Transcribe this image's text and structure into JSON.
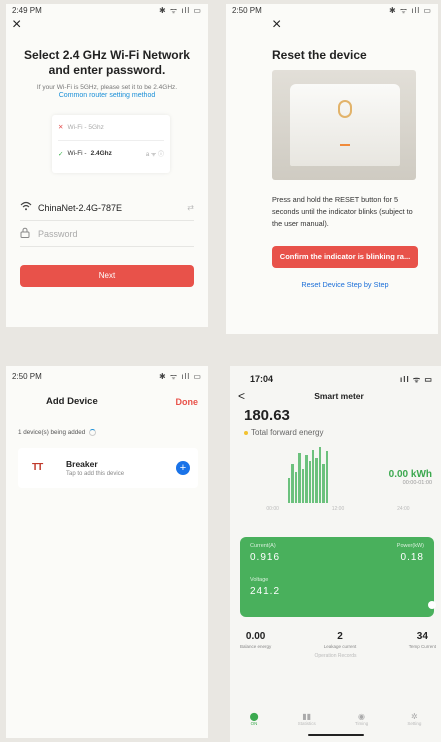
{
  "panel1": {
    "time": "2:49 PM",
    "sys_icons": "✱ ᯤ ıll ▭",
    "close": "×",
    "title": "Select 2.4 GHz Wi-Fi Network and enter password.",
    "subtitle": "If your Wi-Fi is 5GHz, please set it to be 2.4GHz.",
    "link": "Common router setting method",
    "wifi_bad": "Wi-Fi - 5Ghz",
    "wifi_good_prefix": "Wi-Fi - ",
    "wifi_good_band": "2.4Ghz",
    "wifi_end": "a ᯤ ⓘ",
    "ssid": "ChinaNet-2.4G-787E",
    "switch_icon": "⇄",
    "password_placeholder": "Password",
    "next": "Next"
  },
  "panel2": {
    "time": "2:50 PM",
    "sys_icons": "✱ ᯤ ıll ▭",
    "close": "×",
    "title": "Reset the device",
    "instruction": "Press and hold the RESET button for 5 seconds until the indicator blinks (subject to the user manual).",
    "confirm": "Confirm the indicator is blinking ra...",
    "link": "Reset Device Step by Step"
  },
  "panel3": {
    "time": "2:50 PM",
    "sys_icons": "✱ ᯤ ıll ▭",
    "title": "Add Device",
    "done": "Done",
    "count": "1 device(s) being added",
    "logo": "TT",
    "device_name": "Breaker",
    "device_sub": "Tap to add this device",
    "plus": "+"
  },
  "panel4": {
    "time": "17:04",
    "sys_icons": "ıll ᯤ ▭",
    "back": "<",
    "title": "Smart meter",
    "value": "180.63",
    "value_label": "Total forward energy",
    "chart_axis": [
      "00:00",
      "12:00",
      "24:00"
    ],
    "kwh_value": "0.00 kWh",
    "kwh_time": "00:00-01:00",
    "current_label": "Current(A)",
    "current_value": "0.916",
    "power_label": "Power(kW)",
    "power_value": "0.18",
    "voltage_label": "Voltage",
    "voltage_value": "241.2",
    "balance_value": "0.00",
    "balance_label": "Balance energy",
    "leakage_value": "2",
    "leakage_label": "Leakage current",
    "temp_value": "34",
    "temp_label": "Temp Current",
    "operation": "Operation Records",
    "tabs": [
      "ON",
      "Statistics",
      "Timing",
      "Setting"
    ],
    "bar_levels": [
      0.45,
      0.7,
      0.55,
      0.9,
      0.6,
      0.85,
      0.75,
      0.95,
      0.8,
      1.0,
      0.7,
      0.92
    ]
  }
}
